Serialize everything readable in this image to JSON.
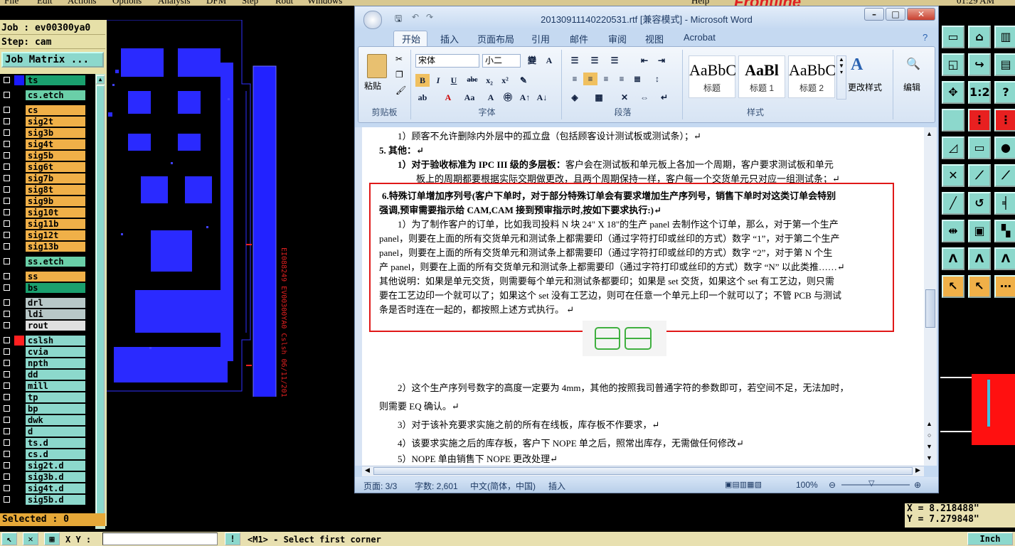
{
  "menubar": {
    "items": [
      "File",
      "Edit",
      "Actions",
      "Options",
      "Analysis",
      "DFM",
      "Step",
      "Rout",
      "Windows",
      "Help"
    ],
    "time": "01:29 AM"
  },
  "job": {
    "job_line": "Job : ev00300ya0",
    "step_line": "Step: cam",
    "matrix_button": "Job Matrix ..."
  },
  "layers": [
    {
      "name": "ts",
      "color": "#1aa06e",
      "swatch": "#1a1aff"
    },
    {
      "name": "cs.etch",
      "color": "#6acfa8"
    },
    {
      "name": "cs",
      "color": "#f0b048"
    },
    {
      "name": "sig2t",
      "color": "#f0b048"
    },
    {
      "name": "sig3b",
      "color": "#f0b048"
    },
    {
      "name": "sig4t",
      "color": "#f0b048"
    },
    {
      "name": "sig5b",
      "color": "#f0b048"
    },
    {
      "name": "sig6t",
      "color": "#f0b048"
    },
    {
      "name": "sig7b",
      "color": "#f0b048"
    },
    {
      "name": "sig8t",
      "color": "#f0b048"
    },
    {
      "name": "sig9b",
      "color": "#f0b048"
    },
    {
      "name": "sig10t",
      "color": "#f0b048"
    },
    {
      "name": "sig11b",
      "color": "#f0b048"
    },
    {
      "name": "sig12t",
      "color": "#f0b048"
    },
    {
      "name": "sig13b",
      "color": "#f0b048"
    },
    {
      "name": "ss.etch",
      "color": "#6acfa8"
    },
    {
      "name": "ss",
      "color": "#f0b048"
    },
    {
      "name": "bs",
      "color": "#1aa06e"
    },
    {
      "name": "drl",
      "color": "#b8c8c8"
    },
    {
      "name": "ldi",
      "color": "#b8c8c8"
    },
    {
      "name": "rout",
      "color": "#e0e0e0"
    },
    {
      "name": "cslsh",
      "color": "#8cd8cc",
      "swatch": "#ff2020"
    },
    {
      "name": "cvia",
      "color": "#8cd8cc"
    },
    {
      "name": "npth",
      "color": "#8cd8cc"
    },
    {
      "name": "dd",
      "color": "#8cd8cc"
    },
    {
      "name": "mill",
      "color": "#8cd8cc"
    },
    {
      "name": "tp",
      "color": "#8cd8cc"
    },
    {
      "name": "bp",
      "color": "#8cd8cc"
    },
    {
      "name": "dwk",
      "color": "#8cd8cc"
    },
    {
      "name": "d",
      "color": "#8cd8cc"
    },
    {
      "name": "ts.d",
      "color": "#8cd8cc"
    },
    {
      "name": "cs.d",
      "color": "#8cd8cc"
    },
    {
      "name": "sig2t.d",
      "color": "#8cd8cc"
    },
    {
      "name": "sig3b.d",
      "color": "#8cd8cc"
    },
    {
      "name": "sig4t.d",
      "color": "#8cd8cc"
    },
    {
      "name": "sig5b.d",
      "color": "#8cd8cc"
    }
  ],
  "selected": "Selected : 0",
  "board_text": "EI088249 EV00300YA0 Cslsh 06/11/2017",
  "logo_text": "Frontline",
  "coords": {
    "x": "X = 8.218488\"",
    "y": "Y = 7.279848\""
  },
  "bottom": {
    "xy_label": "X Y :",
    "prompt": "<M1> - Select first corner",
    "units": "Inch"
  },
  "word": {
    "title": "20130911140220531.rtf [兼容模式] - Microsoft Word",
    "tabs": [
      "开始",
      "插入",
      "页面布局",
      "引用",
      "邮件",
      "审阅",
      "视图",
      "Acrobat"
    ],
    "clipboard": {
      "paste": "粘贴",
      "label": "剪贴板"
    },
    "font": {
      "name": "宋体",
      "size": "小二",
      "label": "字体"
    },
    "paragraph_label": "段落",
    "styles": [
      {
        "sample": "AaBbC",
        "name": "标题"
      },
      {
        "sample": "AaBl",
        "name": "标题 1"
      },
      {
        "sample": "AaBbC",
        "name": "标题 2"
      }
    ],
    "styles_label": "样式",
    "change_styles": "更改样式",
    "editing": "编辑",
    "status": {
      "page": "页面: 3/3",
      "words": "字数: 2,601",
      "lang": "中文(简体，中国)",
      "mode": "插入",
      "zoom": "100%"
    },
    "doc": {
      "l1": "1）顾客不允许删除内外层中的孤立盘（包括顾客设计测试板或测试条）；↵",
      "l2": "5.   其他：↵",
      "l3a": "1）对于验收标准为 IPC III 级的多层板：",
      "l3b": "客户会在测试板和单元板上各加一个周期，客户要求测试板和单元",
      "l4": "板上的周期都要根据实际交期做更改，且两个周期保持一样，客户每一个交货单元只对应一组测试条；↵",
      "l5": "6.特殊订单增加序列号(客户下单时，对于部分特殊订单会有要求增加生产序列号，销售下单时对这类订单会特别",
      "l6": "强调,预审需要指示给 CAM,CAM 接到预审指示时,按如下要求执行:)↵",
      "l7": "1）为了制作客户的订单，比如我司投料 N 块 24\" X 18\"的生产 panel 去制作这个订单，那么，对于第一个生产",
      "l8": "panel，则要在上面的所有交货单元和测试条上都需要印（通过字符打印或丝印的方式）数字 “1”，对于第二个生产",
      "l9": "panel，则要在上面的所有交货单元和测试条上都需要印（通过字符打印或丝印的方式）数字 “2”，对于第 N 个生",
      "l10": "产 panel，则要在上面的所有交货单元和测试条上都需要印（通过字符打印或丝印的方式）数字 “N” 以此类推……↵",
      "l11": "其他说明：如果是单元交货，则需要每个单元和测试条都要印；如果是 set 交货，如果这个 set 有工艺边，则只需",
      "l12": "要在工艺边印一个就可以了；如果这个 set 没有工艺边，则可在任意一个单元上印一个就可以了；不管 PCB 与测试",
      "l13": "条是否时连在一起的，都按照上述方式执行。 ↵",
      "l14": "2）这个生产序列号数字的高度一定要为 4mm，其他的按照我司普通字符的参数即可，若空间不足，无法加时，",
      "l15": "则需要 EQ 确认。↵",
      "l16": "3）对于该补充要求实施之前的所有在线板，库存板不作要求，↵",
      "l17": "4）该要求实施之后的库存板，客户下 NOPE 单之后，照常出库存，无需做任何修改↵",
      "l18": "5）NOPE 单由销售下 NOPE 更改处理↵"
    }
  }
}
